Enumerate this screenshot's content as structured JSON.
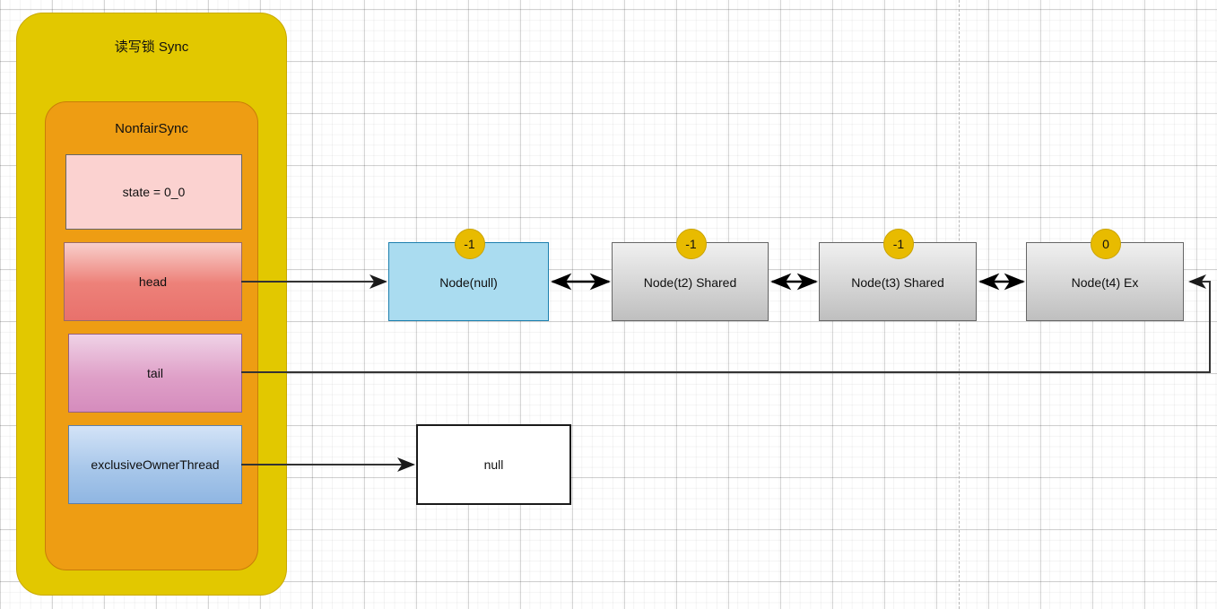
{
  "diagram": {
    "title": "读写锁 Sync",
    "outer_container": {
      "label": "读写锁 Sync",
      "color": "#e2c800"
    },
    "inner_container": {
      "label": "NonfairSync",
      "color": "#ee9d13"
    },
    "fields": [
      {
        "name": "state-field",
        "label": "state = 0_0",
        "color": "#fbd2d0"
      },
      {
        "name": "head-field",
        "label": "head",
        "color": "#ed8179"
      },
      {
        "name": "tail-field",
        "label": "tail",
        "color": "#dfa0c8"
      },
      {
        "name": "owner-field",
        "label": "exclusiveOwnerThread",
        "color": "#a8c7ea"
      }
    ],
    "queue_nodes": [
      {
        "name": "node-head",
        "label": "Node(null)",
        "waitStatus": "-1",
        "style": "head",
        "color": "#aadcf0"
      },
      {
        "name": "node-t2-shared",
        "label": "Node(t2) Shared",
        "waitStatus": "-1",
        "style": "normal",
        "color": "#dadada"
      },
      {
        "name": "node-t3-shared",
        "label": "Node(t3) Shared",
        "waitStatus": "-1",
        "style": "normal",
        "color": "#dadada"
      },
      {
        "name": "node-t4-ex",
        "label": "Node(t4) Ex",
        "waitStatus": "0",
        "style": "normal",
        "color": "#dadada"
      }
    ],
    "owner_value": {
      "label": "null"
    },
    "badge_color": "#e8bb00",
    "connector_color": "#333333",
    "connectors": [
      {
        "from": "head-field",
        "to": "node-head",
        "type": "arrow"
      },
      {
        "from": "node-head",
        "to": "node-t2-shared",
        "type": "double-arrow"
      },
      {
        "from": "node-t2-shared",
        "to": "node-t3-shared",
        "type": "double-arrow"
      },
      {
        "from": "node-t3-shared",
        "to": "node-t4-ex",
        "type": "double-arrow"
      },
      {
        "from": "tail-field",
        "to": "node-t4-ex",
        "type": "arrow"
      },
      {
        "from": "owner-field",
        "to": "owner_value",
        "type": "arrow"
      }
    ]
  }
}
